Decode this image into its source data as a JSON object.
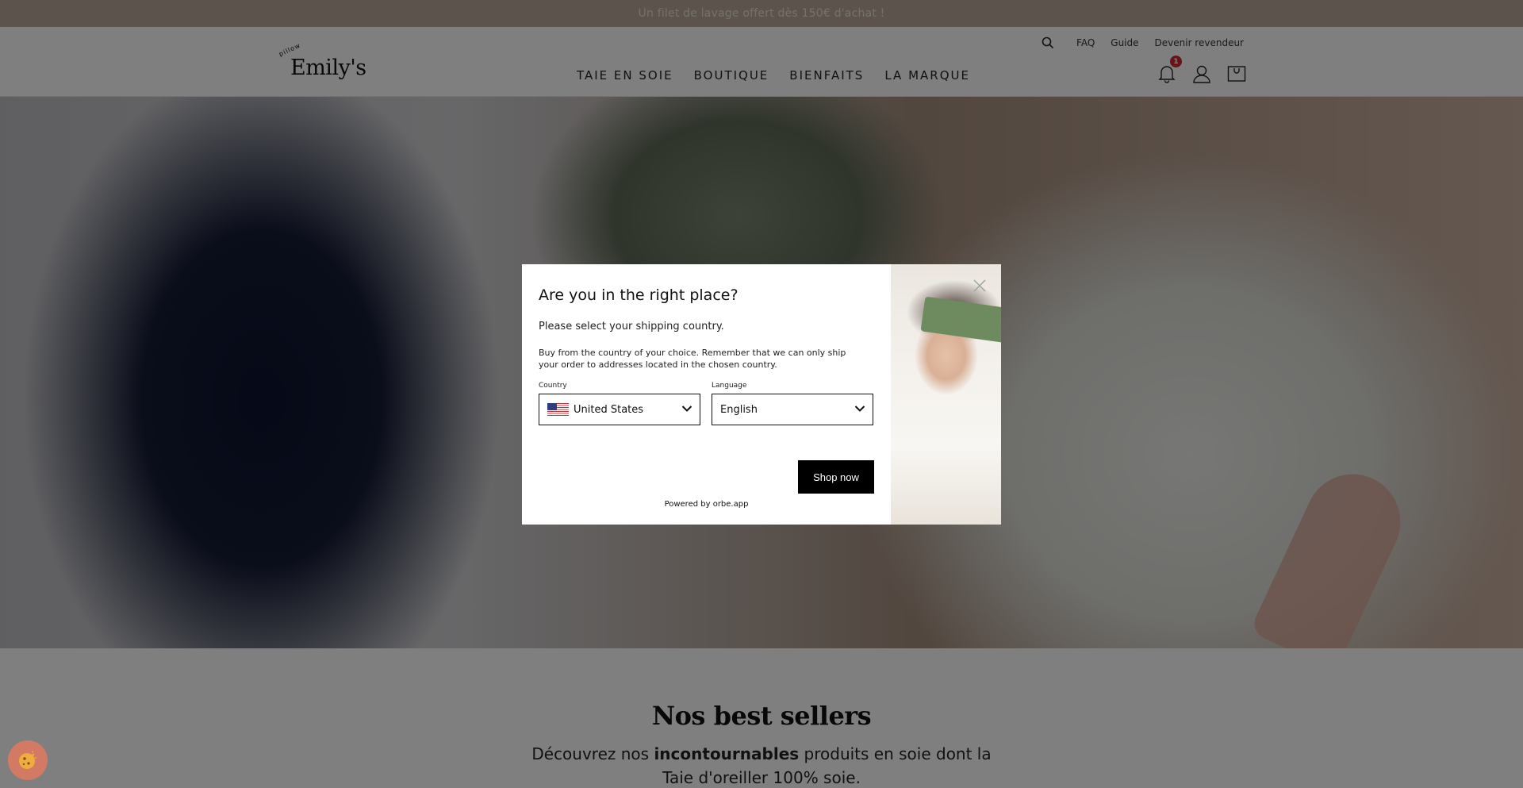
{
  "announcement": "Un filet de lavage offert dès 150€ d'achat !",
  "header": {
    "logo_small": "pillow",
    "logo_brand": "Emily's",
    "utility_links": [
      "FAQ",
      "Guide",
      "Devenir revendeur"
    ],
    "nav": [
      "TAIE EN SOIE",
      "BOUTIQUE",
      "BIENFAITS",
      "LA MARQUE"
    ],
    "notification_count": "1",
    "icons": [
      "search-icon",
      "bell-icon",
      "account-icon",
      "cart-icon"
    ]
  },
  "section": {
    "title": "Nos best sellers",
    "text_before": "Découvrez nos ",
    "text_bold": "incontournables",
    "text_after": " produits en soie dont la Taie d'oreiller 100% soie."
  },
  "modal": {
    "title": "Are you in the right place?",
    "subtitle": "Please select your shipping country.",
    "description": "Buy from the country of your choice. Remember that we can only ship your order to addresses located in the chosen country.",
    "country_label": "Country",
    "country_value": "United States",
    "language_label": "Language",
    "language_value": "English",
    "button": "Shop now",
    "powered": "Powered by orbe.app"
  },
  "colors": {
    "announcement_bg": "#b9a998",
    "badge": "#d0282e",
    "button_bg": "#000000",
    "cookie": "#d77a62"
  }
}
